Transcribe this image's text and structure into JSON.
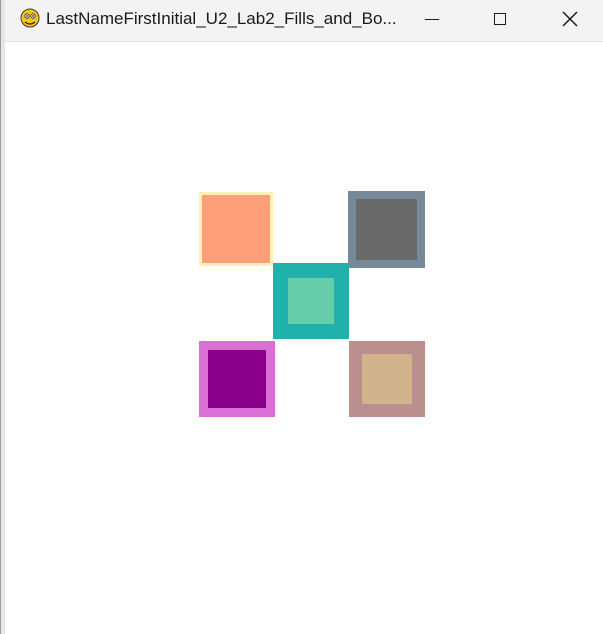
{
  "window": {
    "title": "LastNameFirstInitial_U2_Lab2_Fills_and_Bo..."
  },
  "icons": {
    "app": "pygame-snake-icon",
    "minimize": "minimize-icon",
    "maximize": "maximize-icon",
    "close": "close-icon"
  },
  "squares": [
    {
      "name": "square-top-left",
      "fill": "#ff9f7a",
      "border": "#fff0b8"
    },
    {
      "name": "square-top-right",
      "fill": "#696969",
      "border": "#778899"
    },
    {
      "name": "square-center",
      "fill": "#66cdaa",
      "border": "#20b2aa"
    },
    {
      "name": "square-bottom-left",
      "fill": "#8b008b",
      "border": "#da70d6"
    },
    {
      "name": "square-bottom-right",
      "fill": "#d2b48c",
      "border": "#bc8f8f"
    }
  ]
}
